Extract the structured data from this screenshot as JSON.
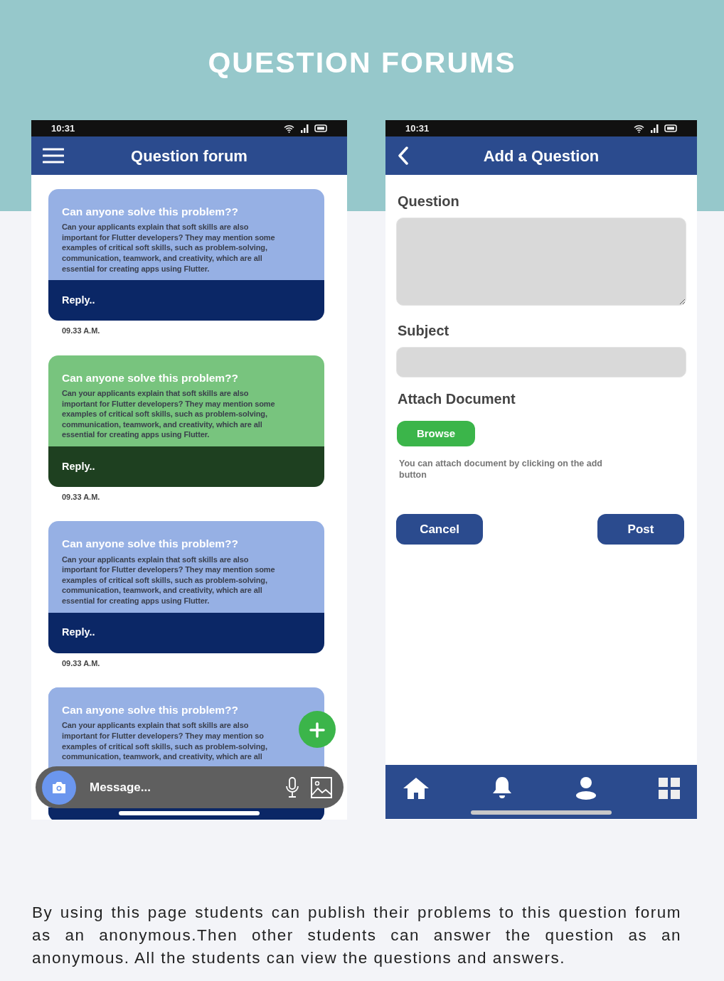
{
  "title": "QUESTION FORUMS",
  "forum_screen": {
    "status_time": "10:31",
    "app_title": "Question forum",
    "cards": [
      {
        "kind": "blue",
        "title": "Can anyone solve this problem??",
        "lines": [
          "Can your applicants explain that soft skills are also",
          "important for Flutter developers? They may mention some",
          "examples of critical soft skills, such as problem-solving,",
          "communication, teamwork, and creativity, which are all",
          "essential for creating apps using Flutter."
        ],
        "reply": "Reply..",
        "time": "09.33 A.M."
      },
      {
        "kind": "green",
        "title": "Can anyone solve this problem??",
        "lines": [
          "Can your applicants explain that soft skills are also",
          "important for Flutter developers? They may mention some",
          "examples of critical soft skills, such as problem-solving,",
          "communication, teamwork, and creativity, which are all",
          "essential for creating apps using Flutter."
        ],
        "reply": "Reply..",
        "time": "09.33 A.M."
      },
      {
        "kind": "blue",
        "title": "Can anyone solve this problem??",
        "lines": [
          "Can your applicants explain that soft skills are also",
          "important for Flutter developers? They may mention some",
          "examples of critical soft skills, such as problem-solving,",
          "communication, teamwork, and creativity, which are all",
          "essential for creating apps using Flutter."
        ],
        "reply": "Reply..",
        "time": "09.33 A.M."
      },
      {
        "kind": "blue",
        "title": "Can anyone solve this problem??",
        "lines": [
          "Can your applicants explain that soft skills are also",
          "important for Flutter developers? They may mention so",
          "examples of critical soft skills, such as problem-solving,",
          "communication, teamwork, and creativity, which are all"
        ]
      }
    ],
    "message_bar": {
      "placeholder": "Message..."
    }
  },
  "add_screen": {
    "status_time": "10:31",
    "app_title": "Add a Question",
    "fields": [
      {
        "label": "Question",
        "kind": "textarea"
      },
      {
        "label": "Subject",
        "kind": "input"
      }
    ],
    "attach_label": "Attach Document",
    "browse_button": "Browse",
    "attach_hint": "You can attach document by clicking on the add button",
    "buttons": [
      "Cancel",
      "Post"
    ]
  },
  "description": "By using this page students can publish their problems to this question forum as an anonymous.Then other students can answer the question as an anonymous. All the students can view the questions and answers."
}
